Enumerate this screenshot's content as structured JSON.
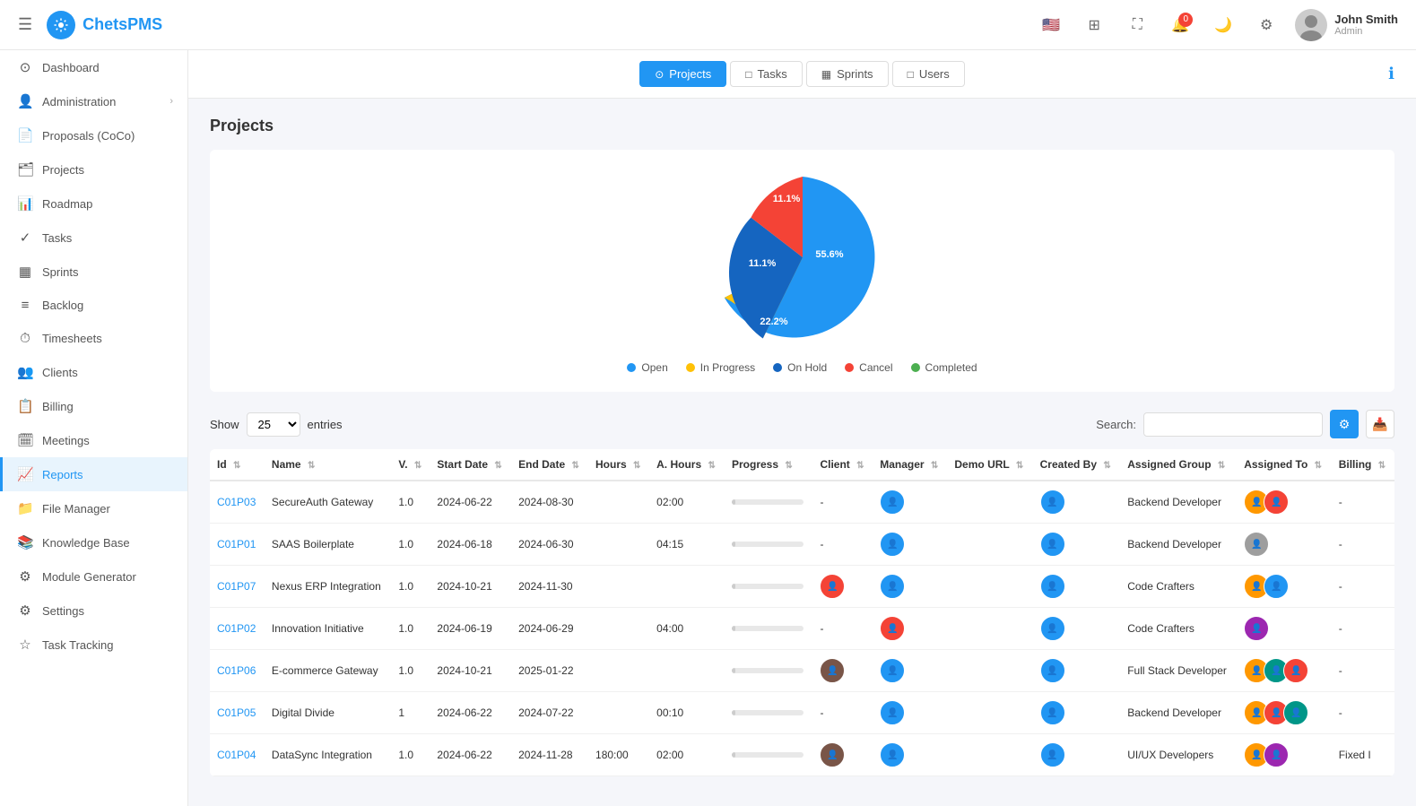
{
  "app": {
    "name": "ChetsPMS",
    "logo_text": "ChetsPMS"
  },
  "header": {
    "hamburger_label": "☰",
    "notification_count": "0",
    "user": {
      "name": "John Smith",
      "role": "Admin"
    }
  },
  "sidebar": {
    "items": [
      {
        "id": "dashboard",
        "label": "Dashboard",
        "icon": "⊙"
      },
      {
        "id": "administration",
        "label": "Administration",
        "icon": "👤",
        "has_arrow": true
      },
      {
        "id": "proposals",
        "label": "Proposals (CoCo)",
        "icon": "📄"
      },
      {
        "id": "projects",
        "label": "Projects",
        "icon": "🗂"
      },
      {
        "id": "roadmap",
        "label": "Roadmap",
        "icon": "📊"
      },
      {
        "id": "tasks",
        "label": "Tasks",
        "icon": "✓"
      },
      {
        "id": "sprints",
        "label": "Sprints",
        "icon": "▦"
      },
      {
        "id": "backlog",
        "label": "Backlog",
        "icon": "≡"
      },
      {
        "id": "timesheets",
        "label": "Timesheets",
        "icon": "⏱"
      },
      {
        "id": "clients",
        "label": "Clients",
        "icon": "👥"
      },
      {
        "id": "billing",
        "label": "Billing",
        "icon": "📋"
      },
      {
        "id": "meetings",
        "label": "Meetings",
        "icon": "🗓"
      },
      {
        "id": "reports",
        "label": "Reports",
        "icon": "📈",
        "active": true
      },
      {
        "id": "file-manager",
        "label": "File Manager",
        "icon": "📁"
      },
      {
        "id": "knowledge-base",
        "label": "Knowledge Base",
        "icon": "📚"
      },
      {
        "id": "module-generator",
        "label": "Module Generator",
        "icon": "⚙"
      },
      {
        "id": "settings",
        "label": "Settings",
        "icon": "⚙"
      },
      {
        "id": "task-tracking",
        "label": "Task Tracking",
        "icon": "☆"
      }
    ]
  },
  "tabs": [
    {
      "id": "projects",
      "label": "Projects",
      "icon": "⊙",
      "active": true
    },
    {
      "id": "tasks",
      "label": "Tasks",
      "icon": "□"
    },
    {
      "id": "sprints",
      "label": "Sprints",
      "icon": "▦"
    },
    {
      "id": "users",
      "label": "Users",
      "icon": "□"
    }
  ],
  "page_title": "Projects",
  "chart": {
    "segments": [
      {
        "label": "Open",
        "value": 55.6,
        "color": "#2196F3",
        "text_color": "#fff"
      },
      {
        "label": "In Progress",
        "value": 22.2,
        "color": "#FFC107",
        "text_color": "#fff"
      },
      {
        "label": "On Hold",
        "value": 11.1,
        "color": "#1565C0",
        "text_color": "#fff"
      },
      {
        "label": "Cancel",
        "value": 11.1,
        "color": "#f44336",
        "text_color": "#fff"
      },
      {
        "label": "Completed",
        "value": 0,
        "color": "#4CAF50",
        "text_color": "#fff"
      }
    ],
    "labels": {
      "open": "55.6%",
      "in_progress": "22.2%",
      "on_hold": "11.1%",
      "cancel": "11.1%"
    }
  },
  "table": {
    "show_label": "Show",
    "entries_label": "entries",
    "show_value": "25",
    "search_label": "Search:",
    "search_placeholder": "",
    "columns": [
      "Id",
      "Name",
      "V.",
      "Start Date",
      "End Date",
      "Hours",
      "A. Hours",
      "Progress",
      "Client",
      "Manager",
      "Demo URL",
      "Created By",
      "Assigned Group",
      "Assigned To",
      "Billing"
    ],
    "rows": [
      {
        "id": "C01P03",
        "name": "SecureAuth Gateway",
        "v": "1.0",
        "start": "2024-06-22",
        "end": "2024-08-30",
        "hours": "",
        "a_hours": "02:00",
        "progress": 5,
        "client": "-",
        "manager": "av-blue",
        "demo": "",
        "created_by": "av-blue",
        "group": "Backend Developer",
        "assigned_to": "multi",
        "billing": "-"
      },
      {
        "id": "C01P01",
        "name": "SAAS Boilerplate",
        "v": "1.0",
        "start": "2024-06-18",
        "end": "2024-06-30",
        "hours": "",
        "a_hours": "04:15",
        "progress": 5,
        "client": "-",
        "manager": "av-blue",
        "demo": "",
        "created_by": "av-blue",
        "group": "Backend Developer",
        "assigned_to": "single",
        "billing": "-"
      },
      {
        "id": "C01P07",
        "name": "Nexus ERP Integration",
        "v": "1.0",
        "start": "2024-10-21",
        "end": "2024-11-30",
        "hours": "",
        "a_hours": "",
        "progress": 5,
        "client": "av-red",
        "manager": "av-blue",
        "demo": "",
        "created_by": "av-blue",
        "group": "Code Crafters",
        "assigned_to": "multi2",
        "billing": "-"
      },
      {
        "id": "C01P02",
        "name": "Innovation Initiative",
        "v": "1.0",
        "start": "2024-06-19",
        "end": "2024-06-29",
        "hours": "",
        "a_hours": "04:00",
        "progress": 5,
        "client": "-",
        "manager": "av-red",
        "demo": "",
        "created_by": "av-blue",
        "group": "Code Crafters",
        "assigned_to": "single2",
        "billing": "-"
      },
      {
        "id": "C01P06",
        "name": "E-commerce Gateway",
        "v": "1.0",
        "start": "2024-10-21",
        "end": "2025-01-22",
        "hours": "",
        "a_hours": "",
        "progress": 5,
        "client": "av-brown",
        "manager": "av-blue",
        "demo": "",
        "created_by": "av-blue",
        "group": "Full Stack Developer",
        "assigned_to": "multi3",
        "billing": "-"
      },
      {
        "id": "C01P05",
        "name": "Digital Divide",
        "v": "1",
        "start": "2024-06-22",
        "end": "2024-07-22",
        "hours": "",
        "a_hours": "00:10",
        "progress": 5,
        "client": "-",
        "manager": "av-blue",
        "demo": "",
        "created_by": "av-blue",
        "group": "Backend Developer",
        "assigned_to": "multi4",
        "billing": "-"
      },
      {
        "id": "C01P04",
        "name": "DataSync Integration",
        "v": "1.0",
        "start": "2024-06-22",
        "end": "2024-11-28",
        "hours": "180:00",
        "a_hours": "02:00",
        "progress": 5,
        "client": "av-brown",
        "manager": "av-blue",
        "demo": "",
        "created_by": "av-blue",
        "group": "UI/UX Developers",
        "assigned_to": "multi5",
        "billing": "Fixed I"
      }
    ]
  },
  "colors": {
    "primary": "#2196F3",
    "active_bg": "#e8f4fd",
    "border": "#e8e8e8"
  }
}
